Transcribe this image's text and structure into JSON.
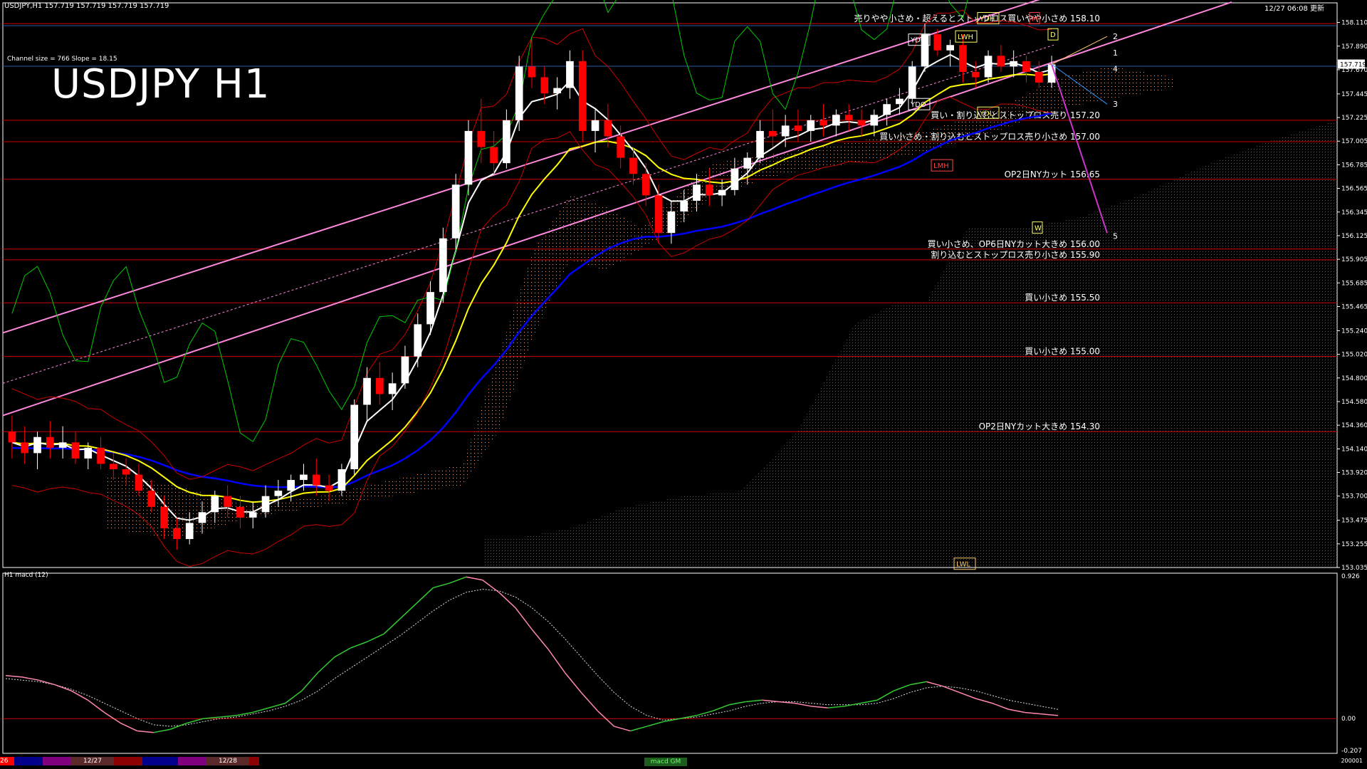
{
  "header": {
    "symbol_line": "USDJPY,H1  157.719 157.719 157.719 157.719",
    "time_line": "12/27 06:08 更新"
  },
  "channel_info": "Channel size = 766 Slope = 18.15",
  "big_title": "USDJPY H1",
  "macd_title": "H1  macd (12)",
  "timebar": {
    "labels": [
      "26",
      "12/27",
      "12/28"
    ],
    "macd_tag": "macd GM",
    "right_label": "200001"
  },
  "colors": {
    "background": "#000000",
    "bull_candle": "#ffffff",
    "bear_candle": "#ff0000",
    "level_line": "#cc0000",
    "channel_line": "#ff88dd",
    "ema_white": "#ffffff",
    "ema_yellow": "#ffff00",
    "ema_blue": "#0000ff",
    "cloud_a": "#ff9966",
    "cloud_b": "#3355ff",
    "chikou": "#00cc00",
    "bollinger": "#cc0000",
    "macd_up": "#33cc33",
    "macd_down": "#ff88aa"
  },
  "chart_data": [
    {
      "type": "candlestick",
      "title": "USDJPY H1",
      "price_axis_ticks": [
        "158.110",
        "157.890",
        "157.670",
        "157.445",
        "157.225",
        "157.005",
        "156.785",
        "156.565",
        "156.345",
        "156.125",
        "155.905",
        "155.685",
        "155.465",
        "155.240",
        "155.020",
        "154.800",
        "154.580",
        "154.360",
        "154.140",
        "153.920",
        "153.700",
        "153.475",
        "153.255",
        "153.035"
      ],
      "current_price": "157.719",
      "ylim": [
        153.035,
        158.2
      ],
      "candles": [
        {
          "o": 154.3,
          "h": 154.45,
          "l": 154.05,
          "c": 154.2
        },
        {
          "o": 154.2,
          "h": 154.35,
          "l": 154.0,
          "c": 154.1
        },
        {
          "o": 154.1,
          "h": 154.3,
          "l": 153.95,
          "c": 154.25
        },
        {
          "o": 154.25,
          "h": 154.4,
          "l": 154.05,
          "c": 154.15
        },
        {
          "o": 154.15,
          "h": 154.35,
          "l": 154.05,
          "c": 154.2
        },
        {
          "o": 154.2,
          "h": 154.3,
          "l": 154.0,
          "c": 154.05
        },
        {
          "o": 154.05,
          "h": 154.2,
          "l": 153.95,
          "c": 154.15
        },
        {
          "o": 154.15,
          "h": 154.25,
          "l": 153.95,
          "c": 154.0
        },
        {
          "o": 154.0,
          "h": 154.1,
          "l": 153.85,
          "c": 153.95
        },
        {
          "o": 153.95,
          "h": 154.05,
          "l": 153.8,
          "c": 153.9
        },
        {
          "o": 153.9,
          "h": 154.0,
          "l": 153.7,
          "c": 153.75
        },
        {
          "o": 153.75,
          "h": 153.85,
          "l": 153.55,
          "c": 153.6
        },
        {
          "o": 153.6,
          "h": 153.7,
          "l": 153.3,
          "c": 153.4
        },
        {
          "o": 153.4,
          "h": 153.5,
          "l": 153.2,
          "c": 153.3
        },
        {
          "o": 153.3,
          "h": 153.55,
          "l": 153.25,
          "c": 153.45
        },
        {
          "o": 153.45,
          "h": 153.65,
          "l": 153.35,
          "c": 153.55
        },
        {
          "o": 153.55,
          "h": 153.75,
          "l": 153.45,
          "c": 153.7
        },
        {
          "o": 153.7,
          "h": 153.8,
          "l": 153.5,
          "c": 153.6
        },
        {
          "o": 153.6,
          "h": 153.7,
          "l": 153.4,
          "c": 153.5
        },
        {
          "o": 153.5,
          "h": 153.65,
          "l": 153.4,
          "c": 153.55
        },
        {
          "o": 153.55,
          "h": 153.8,
          "l": 153.5,
          "c": 153.7
        },
        {
          "o": 153.7,
          "h": 153.85,
          "l": 153.6,
          "c": 153.75
        },
        {
          "o": 153.75,
          "h": 153.9,
          "l": 153.65,
          "c": 153.85
        },
        {
          "o": 153.85,
          "h": 154.0,
          "l": 153.75,
          "c": 153.9
        },
        {
          "o": 153.9,
          "h": 154.05,
          "l": 153.7,
          "c": 153.8
        },
        {
          "o": 153.8,
          "h": 153.9,
          "l": 153.65,
          "c": 153.75
        },
        {
          "o": 153.75,
          "h": 154.0,
          "l": 153.7,
          "c": 153.95
        },
        {
          "o": 153.95,
          "h": 154.6,
          "l": 153.9,
          "c": 154.55
        },
        {
          "o": 154.55,
          "h": 154.9,
          "l": 154.4,
          "c": 154.8
        },
        {
          "o": 154.8,
          "h": 154.95,
          "l": 154.55,
          "c": 154.65
        },
        {
          "o": 154.65,
          "h": 154.85,
          "l": 154.5,
          "c": 154.75
        },
        {
          "o": 154.75,
          "h": 155.1,
          "l": 154.7,
          "c": 155.0
        },
        {
          "o": 155.0,
          "h": 155.4,
          "l": 154.9,
          "c": 155.3
        },
        {
          "o": 155.3,
          "h": 155.7,
          "l": 155.2,
          "c": 155.6
        },
        {
          "o": 155.6,
          "h": 156.2,
          "l": 155.5,
          "c": 156.1
        },
        {
          "o": 156.1,
          "h": 156.7,
          "l": 156.0,
          "c": 156.6
        },
        {
          "o": 156.6,
          "h": 157.2,
          "l": 156.5,
          "c": 157.1
        },
        {
          "o": 157.1,
          "h": 157.4,
          "l": 156.8,
          "c": 156.95
        },
        {
          "o": 156.95,
          "h": 157.1,
          "l": 156.7,
          "c": 156.8
        },
        {
          "o": 156.8,
          "h": 157.3,
          "l": 156.75,
          "c": 157.2
        },
        {
          "o": 157.2,
          "h": 157.8,
          "l": 157.1,
          "c": 157.7
        },
        {
          "o": 157.7,
          "h": 157.95,
          "l": 157.5,
          "c": 157.6
        },
        {
          "o": 157.6,
          "h": 157.7,
          "l": 157.35,
          "c": 157.45
        },
        {
          "o": 157.45,
          "h": 157.6,
          "l": 157.3,
          "c": 157.5
        },
        {
          "o": 157.5,
          "h": 157.85,
          "l": 157.4,
          "c": 157.75
        },
        {
          "o": 157.75,
          "h": 157.85,
          "l": 157.0,
          "c": 157.1
        },
        {
          "o": 157.1,
          "h": 157.3,
          "l": 156.9,
          "c": 157.2
        },
        {
          "o": 157.2,
          "h": 157.35,
          "l": 156.95,
          "c": 157.05
        },
        {
          "o": 157.05,
          "h": 157.15,
          "l": 156.75,
          "c": 156.85
        },
        {
          "o": 156.85,
          "h": 156.95,
          "l": 156.6,
          "c": 156.7
        },
        {
          "o": 156.7,
          "h": 156.8,
          "l": 156.4,
          "c": 156.5
        },
        {
          "o": 156.5,
          "h": 156.6,
          "l": 156.05,
          "c": 156.15
        },
        {
          "o": 156.15,
          "h": 156.45,
          "l": 156.05,
          "c": 156.35
        },
        {
          "o": 156.35,
          "h": 156.55,
          "l": 156.25,
          "c": 156.45
        },
        {
          "o": 156.45,
          "h": 156.7,
          "l": 156.35,
          "c": 156.6
        },
        {
          "o": 156.6,
          "h": 156.75,
          "l": 156.4,
          "c": 156.5
        },
        {
          "o": 156.5,
          "h": 156.65,
          "l": 156.4,
          "c": 156.55
        },
        {
          "o": 156.55,
          "h": 156.85,
          "l": 156.5,
          "c": 156.75
        },
        {
          "o": 156.75,
          "h": 156.9,
          "l": 156.6,
          "c": 156.85
        },
        {
          "o": 156.85,
          "h": 157.2,
          "l": 156.8,
          "c": 157.1
        },
        {
          "o": 157.1,
          "h": 157.3,
          "l": 156.95,
          "c": 157.05
        },
        {
          "o": 157.05,
          "h": 157.25,
          "l": 156.95,
          "c": 157.15
        },
        {
          "o": 157.15,
          "h": 157.3,
          "l": 157.0,
          "c": 157.1
        },
        {
          "o": 157.1,
          "h": 157.25,
          "l": 157.0,
          "c": 157.2
        },
        {
          "o": 157.2,
          "h": 157.35,
          "l": 157.05,
          "c": 157.15
        },
        {
          "o": 157.15,
          "h": 157.3,
          "l": 157.05,
          "c": 157.25
        },
        {
          "o": 157.25,
          "h": 157.35,
          "l": 157.1,
          "c": 157.2
        },
        {
          "o": 157.2,
          "h": 157.3,
          "l": 157.05,
          "c": 157.15
        },
        {
          "o": 157.15,
          "h": 157.3,
          "l": 157.05,
          "c": 157.25
        },
        {
          "o": 157.25,
          "h": 157.4,
          "l": 157.15,
          "c": 157.35
        },
        {
          "o": 157.35,
          "h": 157.5,
          "l": 157.25,
          "c": 157.4
        },
        {
          "o": 157.4,
          "h": 157.75,
          "l": 157.35,
          "c": 157.7
        },
        {
          "o": 157.7,
          "h": 158.1,
          "l": 157.65,
          "c": 158.0
        },
        {
          "o": 158.0,
          "h": 158.05,
          "l": 157.8,
          "c": 157.85
        },
        {
          "o": 157.85,
          "h": 157.95,
          "l": 157.7,
          "c": 157.9
        },
        {
          "o": 157.9,
          "h": 158.0,
          "l": 157.55,
          "c": 157.65
        },
        {
          "o": 157.65,
          "h": 157.75,
          "l": 157.5,
          "c": 157.6
        },
        {
          "o": 157.6,
          "h": 157.85,
          "l": 157.55,
          "c": 157.8
        },
        {
          "o": 157.8,
          "h": 157.9,
          "l": 157.65,
          "c": 157.7
        },
        {
          "o": 157.7,
          "h": 157.85,
          "l": 157.6,
          "c": 157.75
        },
        {
          "o": 157.75,
          "h": 157.8,
          "l": 157.55,
          "c": 157.65
        },
        {
          "o": 157.65,
          "h": 157.75,
          "l": 157.5,
          "c": 157.55
        },
        {
          "o": 157.55,
          "h": 157.8,
          "l": 157.5,
          "c": 157.72
        }
      ],
      "price_levels": [
        {
          "price": 158.1,
          "label": "売りやや小さめ・超えるとストップロス買いやや小さめ 158.10"
        },
        {
          "price": 157.2,
          "label": "買い・割り込むとストップロス売り 157.20"
        },
        {
          "price": 157.0,
          "label": "買い小さめ・割り込むとストップロス売り小さめ 157.00"
        },
        {
          "price": 156.65,
          "label": "OP2日NYカット 156.65"
        },
        {
          "price": 156.0,
          "label": "買い小さめ、OP6日NYカット大きめ 156.00"
        },
        {
          "price": 155.9,
          "label": "割り込むとストップロス売り小さめ 155.90"
        },
        {
          "price": 155.5,
          "label": "買い小さめ 155.50"
        },
        {
          "price": 155.0,
          "label": "買い小さめ 155.00"
        },
        {
          "price": 154.3,
          "label": "OP2日NYカット大きめ 154.30"
        }
      ],
      "reference_boxes": [
        "YDH",
        "LWH",
        "YDC",
        "YDO",
        "YDL",
        "LMH",
        "LWL",
        "D",
        "W",
        "M"
      ],
      "projection_labels": [
        "1",
        "2",
        "3",
        "4",
        "5"
      ]
    },
    {
      "type": "line",
      "title": "H1  macd (12)",
      "y_axis_ticks": [
        "0.926",
        "0.00",
        "-0.207"
      ],
      "ylim": [
        -0.207,
        0.926
      ],
      "macd": [
        0.28,
        0.27,
        0.25,
        0.22,
        0.18,
        0.12,
        0.04,
        -0.03,
        -0.08,
        -0.09,
        -0.07,
        -0.03,
        0.0,
        0.01,
        0.02,
        0.04,
        0.07,
        0.1,
        0.18,
        0.3,
        0.4,
        0.46,
        0.5,
        0.55,
        0.65,
        0.75,
        0.85,
        0.88,
        0.92,
        0.9,
        0.82,
        0.72,
        0.58,
        0.45,
        0.3,
        0.17,
        0.05,
        -0.05,
        -0.08,
        -0.05,
        -0.02,
        0.0,
        0.02,
        0.05,
        0.09,
        0.11,
        0.12,
        0.11,
        0.1,
        0.08,
        0.07,
        0.08,
        0.1,
        0.12,
        0.18,
        0.22,
        0.24,
        0.21,
        0.17,
        0.13,
        0.1,
        0.06,
        0.04,
        0.03,
        0.02
      ],
      "signal": [
        0.26,
        0.25,
        0.24,
        0.22,
        0.19,
        0.15,
        0.1,
        0.05,
        0.0,
        -0.04,
        -0.05,
        -0.04,
        -0.02,
        0.0,
        0.01,
        0.03,
        0.05,
        0.08,
        0.12,
        0.18,
        0.26,
        0.33,
        0.4,
        0.47,
        0.54,
        0.62,
        0.7,
        0.77,
        0.82,
        0.84,
        0.83,
        0.79,
        0.72,
        0.63,
        0.52,
        0.4,
        0.28,
        0.17,
        0.08,
        0.02,
        -0.01,
        0.0,
        0.01,
        0.03,
        0.05,
        0.08,
        0.1,
        0.11,
        0.11,
        0.1,
        0.09,
        0.09,
        0.09,
        0.1,
        0.13,
        0.17,
        0.2,
        0.21,
        0.2,
        0.18,
        0.15,
        0.12,
        0.1,
        0.08,
        0.06
      ]
    }
  ]
}
